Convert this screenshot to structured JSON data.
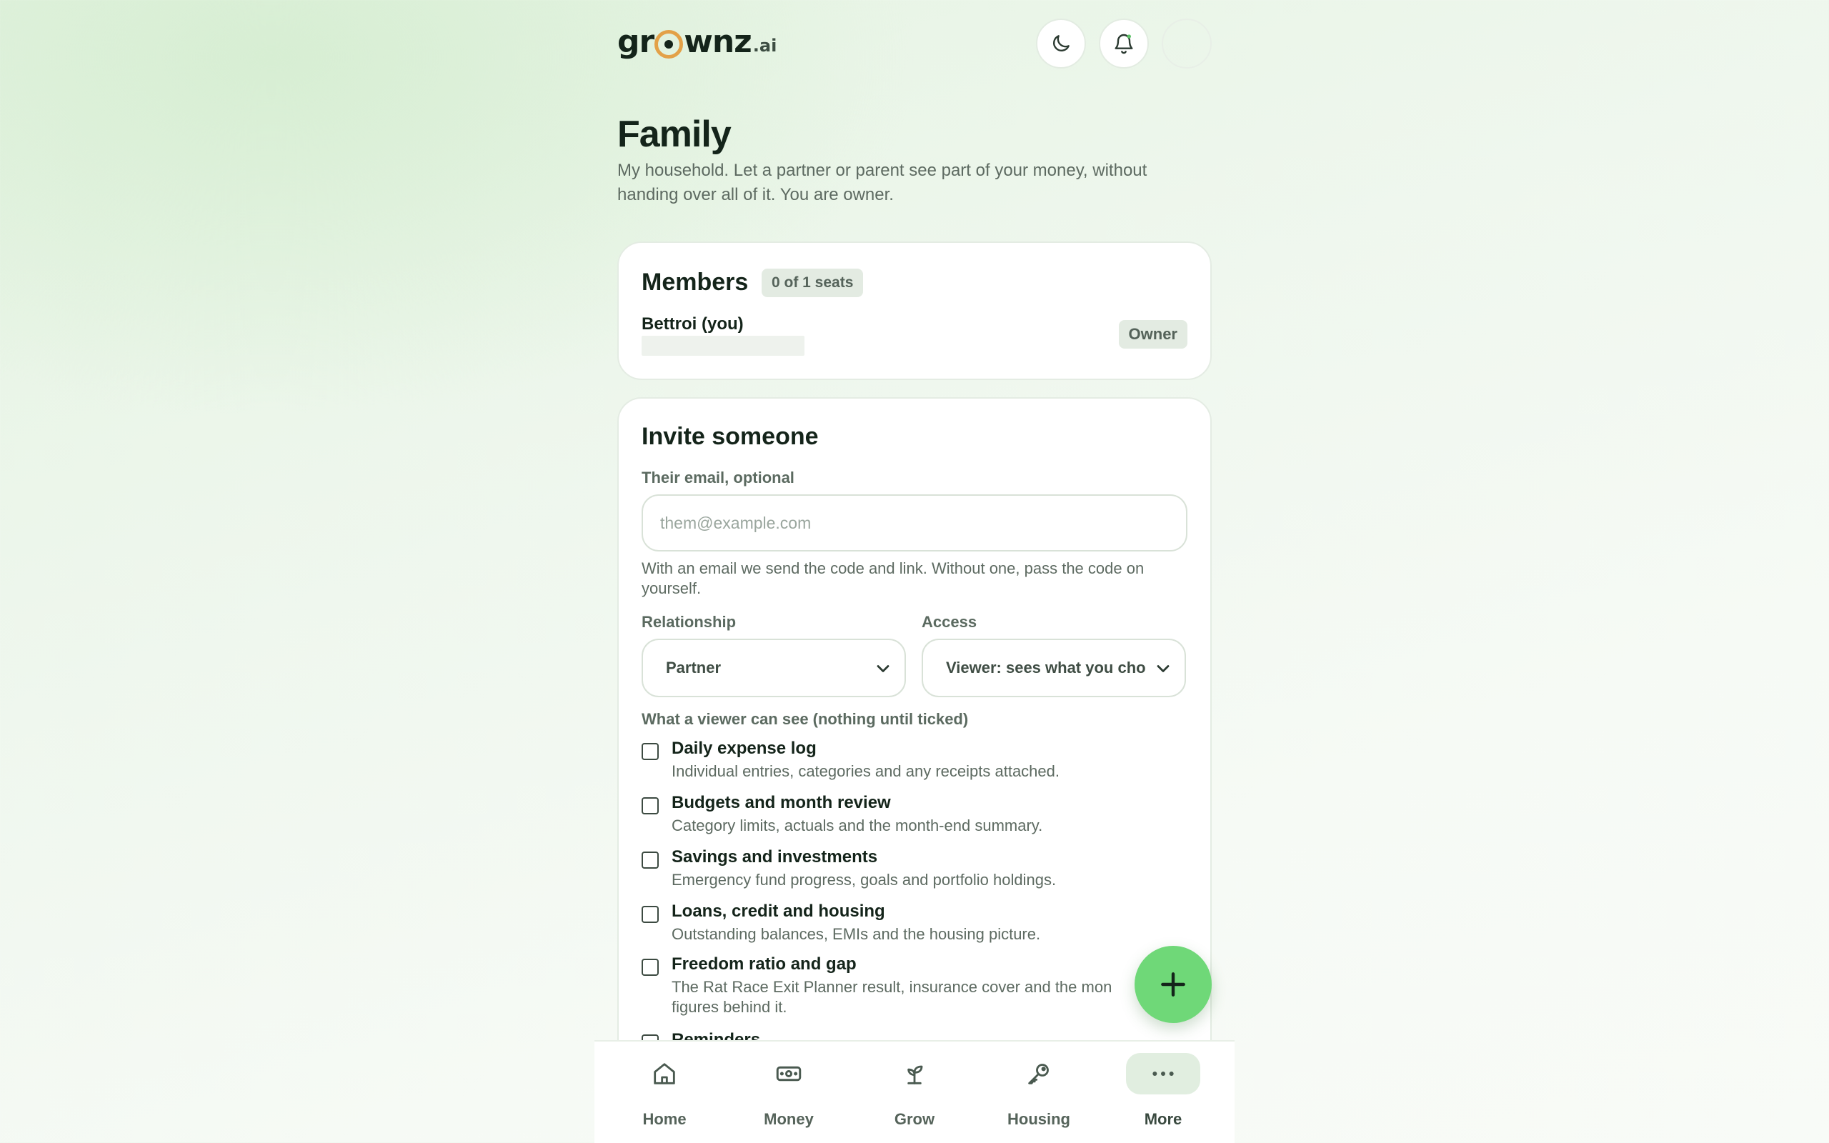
{
  "brand": {
    "name_part1": "gr",
    "name_part2": "wnz",
    "tld": ".ai",
    "ring_color": "#e3a148"
  },
  "header": {
    "buttons": [
      {
        "icon": "moon-icon"
      },
      {
        "icon": "bell-icon"
      },
      {
        "icon": "avatar"
      }
    ]
  },
  "page": {
    "title": "Family",
    "subtitle": "My household. Let a partner or parent see part of your money, without handing over all of it. You are owner."
  },
  "members": {
    "title": "Members",
    "seats": "0 of 1 seats",
    "list": [
      {
        "name": "Bettroi (you)",
        "role": "Owner"
      }
    ]
  },
  "invite": {
    "title": "Invite someone",
    "email_label": "Their email, optional",
    "email_placeholder": "them@example.com",
    "email_value": "",
    "email_help": "With an email we send the code and link. Without one, pass the code on yourself.",
    "relationship_label": "Relationship",
    "relationship_value": "Partner",
    "access_label": "Access",
    "access_value": "Viewer: sees what you cho",
    "viewer_label": "What a viewer can see (nothing until ticked)",
    "options": [
      {
        "title": "Daily expense log",
        "desc": "Individual entries, categories and any receipts attached.",
        "checked": false
      },
      {
        "title": "Budgets and month review",
        "desc": "Category limits, actuals and the month-end summary.",
        "checked": false
      },
      {
        "title": "Savings and investments",
        "desc": "Emergency fund progress, goals and portfolio holdings.",
        "checked": false
      },
      {
        "title": "Loans, credit and housing",
        "desc": "Outstanding balances, EMIs and the housing picture.",
        "checked": false
      },
      {
        "title": "Freedom ratio and gap",
        "desc": "The Rat Race Exit Planner result, insurance cover and the mon figures behind it.",
        "checked": false
      },
      {
        "title": "Reminders",
        "desc": "",
        "checked": false
      }
    ]
  },
  "fab": {
    "icon": "plus-icon",
    "color": "#6fd878"
  },
  "bottom_nav": [
    {
      "label": "Home",
      "icon": "home-icon",
      "active": false
    },
    {
      "label": "Money",
      "icon": "money-icon",
      "active": false
    },
    {
      "label": "Grow",
      "icon": "sprout-icon",
      "active": false
    },
    {
      "label": "Housing",
      "icon": "key-icon",
      "active": false
    },
    {
      "label": "More",
      "icon": "more-icon",
      "active": true
    }
  ]
}
